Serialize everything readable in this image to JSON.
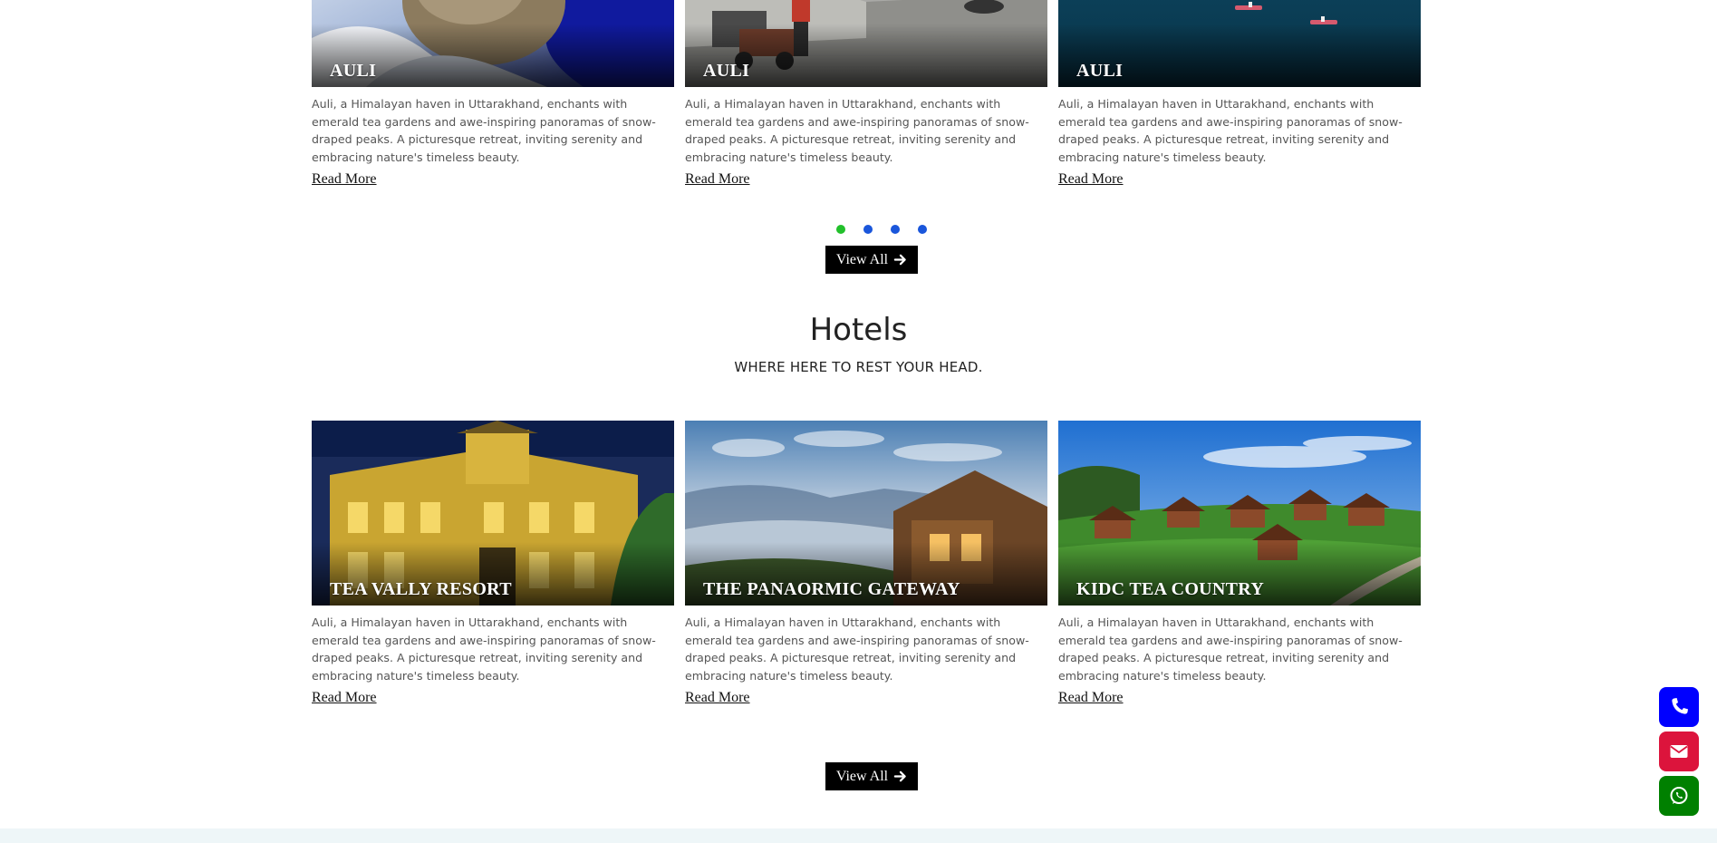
{
  "destinations": {
    "cards": [
      {
        "title": "AULI",
        "desc": "Auli, a Himalayan haven in Uttarakhand, enchants with emerald tea gardens and awe-inspiring panoramas of snow-draped peaks. A picturesque retreat, inviting serenity and embracing nature's timeless beauty.",
        "link": "Read More"
      },
      {
        "title": "AULI",
        "desc": "Auli, a Himalayan haven in Uttarakhand, enchants with emerald tea gardens and awe-inspiring panoramas of snow-draped peaks. A picturesque retreat, inviting serenity and embracing nature's timeless beauty.",
        "link": "Read More"
      },
      {
        "title": "AULI",
        "desc": "Auli, a Himalayan haven in Uttarakhand, enchants with emerald tea gardens and awe-inspiring panoramas of snow-draped peaks. A picturesque retreat, inviting serenity and embracing nature's timeless beauty.",
        "link": "Read More"
      }
    ],
    "carousel": {
      "count": 4,
      "active_index": 0,
      "active_color": "#22c02b",
      "inactive_color": "#1a56db"
    },
    "view_all": "View All"
  },
  "hotels": {
    "title": "Hotels",
    "subtitle": "WHERE HERE TO REST YOUR HEAD.",
    "cards": [
      {
        "title": "TEA VALLY RESORT",
        "desc": "Auli, a Himalayan haven in Uttarakhand, enchants with emerald tea gardens and awe-inspiring panoramas of snow-draped peaks. A picturesque retreat, inviting serenity and embracing nature's timeless beauty.",
        "link": "Read More"
      },
      {
        "title": "THE PANAORMIC GATEWAY",
        "desc": "Auli, a Himalayan haven in Uttarakhand, enchants with emerald tea gardens and awe-inspiring panoramas of snow-draped peaks. A picturesque retreat, inviting serenity and embracing nature's timeless beauty.",
        "link": "Read More"
      },
      {
        "title": "KIDC TEA COUNTRY",
        "desc": "Auli, a Himalayan haven in Uttarakhand, enchants with emerald tea gardens and awe-inspiring panoramas of snow-draped peaks. A picturesque retreat, inviting serenity and embracing nature's timeless beauty.",
        "link": "Read More"
      }
    ],
    "view_all": "View All"
  },
  "floating_actions": [
    {
      "name": "phone-icon",
      "color": "#0000ff"
    },
    {
      "name": "envelope-icon",
      "color": "#dc143c"
    },
    {
      "name": "whatsapp-icon",
      "color": "#008000"
    }
  ]
}
